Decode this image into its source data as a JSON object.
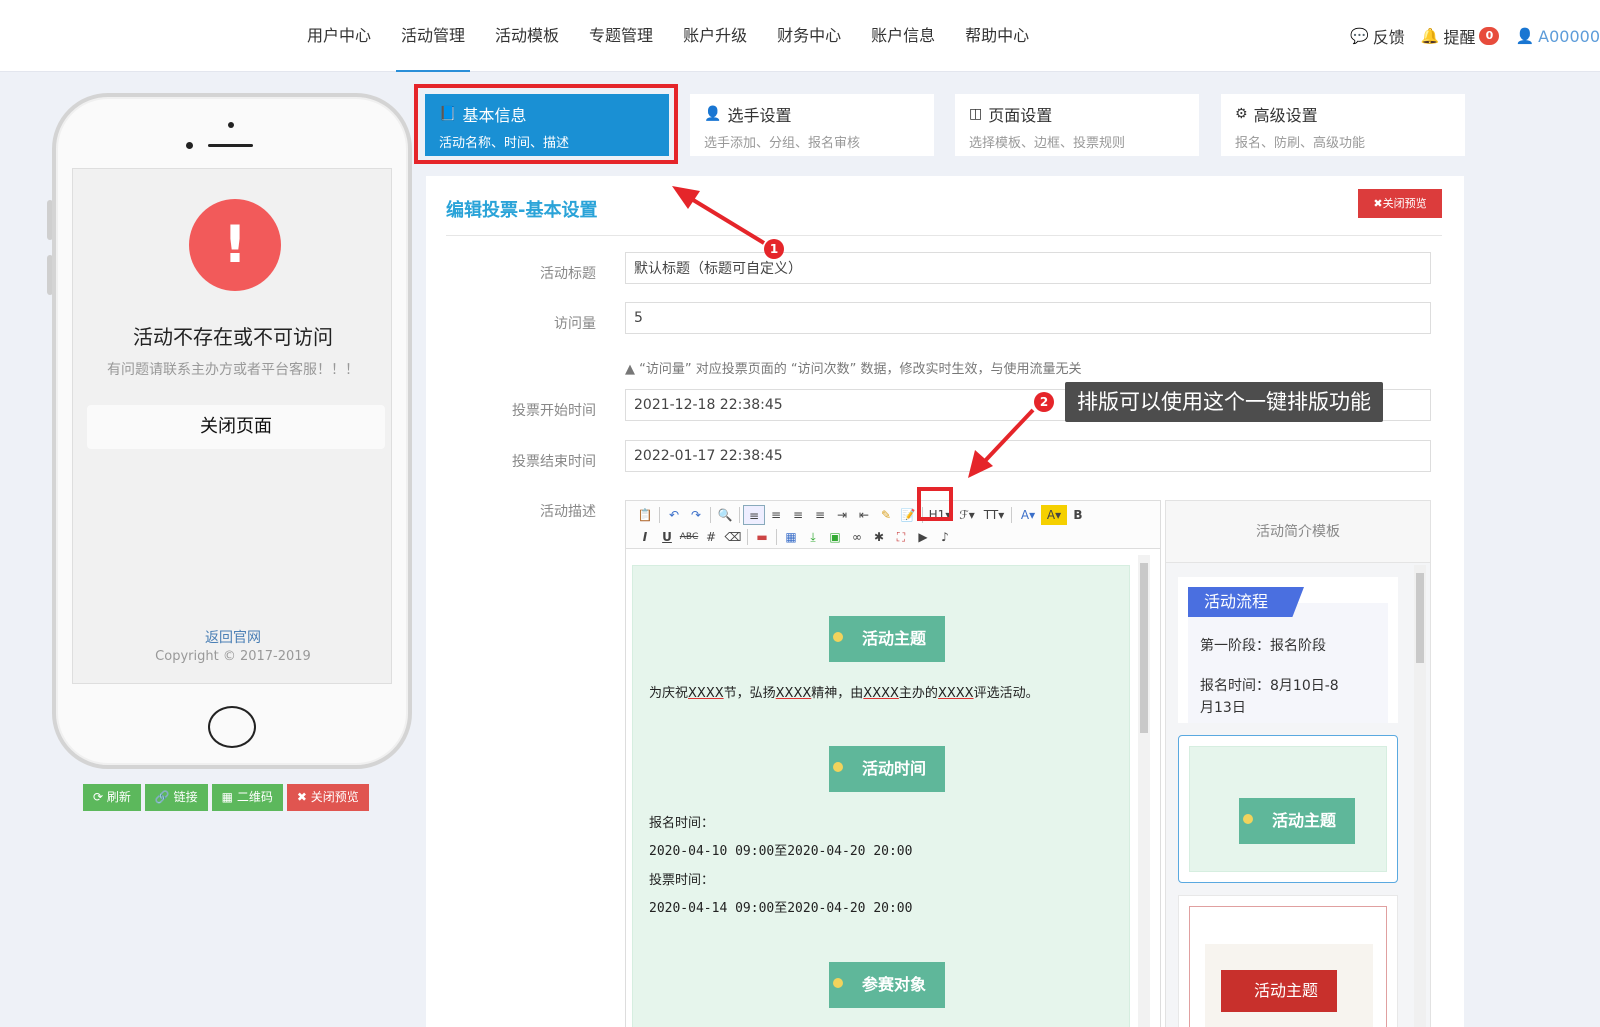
{
  "nav": {
    "items": [
      "用户中心",
      "活动管理",
      "活动模板",
      "专题管理",
      "账户升级",
      "财务中心",
      "账户信息",
      "帮助中心"
    ],
    "active_index": 1,
    "feedback": "反馈",
    "notify": "提醒",
    "notify_count": "0",
    "user": "A00000"
  },
  "phone": {
    "error_icon": "!",
    "error_title": "活动不存在或不可访问",
    "error_sub": "有问题请联系主办方或者平台客服！！！",
    "close_page": "关闭页面",
    "back_link": "返回官网",
    "copyright": "Copyright © 2017-2019",
    "buttons": {
      "refresh": "刷新",
      "link": "链接",
      "qrcode": "二维码",
      "close_preview": "关闭预览"
    }
  },
  "steps": [
    {
      "icon": "book-icon",
      "title": "基本信息",
      "sub": "活动名称、时间、描述"
    },
    {
      "icon": "user-icon",
      "title": "选手设置",
      "sub": "选手添加、分组、报名审核"
    },
    {
      "icon": "layout-icon",
      "title": "页面设置",
      "sub": "选择模板、边框、投票规则"
    },
    {
      "icon": "gear-icon",
      "title": "高级设置",
      "sub": "报名、防刷、高级功能"
    }
  ],
  "panel": {
    "title": "编辑投票-基本设置",
    "close_preview": "关闭预览",
    "fields": {
      "title_label": "活动标题",
      "title_value": "默认标题（标题可自定义）",
      "views_label": "访问量",
      "views_value": "5",
      "views_hint": "▲ “访问量” 对应投票页面的 “访问次数” 数据，修改实时生效，与使用流量无关",
      "start_label": "投票开始时间",
      "start_value": "2021-12-18 22:38:45",
      "end_label": "投票结束时间",
      "end_value": "2022-01-17 22:38:45",
      "desc_label": "活动描述"
    }
  },
  "editor": {
    "toolbar_row1": [
      "📋",
      "↶",
      "↷",
      "🔍",
      "≡",
      "≡",
      "≡",
      "≡",
      "⇥",
      "⇤",
      "✎",
      "📝",
      "H1▾",
      "ℱ▾",
      "TT▾",
      "A▾",
      "A▾",
      "B"
    ],
    "toolbar_row2": [
      "I",
      "U",
      "ABC",
      "#",
      "⌫",
      "▬",
      "▦",
      "⤓",
      "▣",
      "∞",
      "✱",
      "⛶",
      "▶",
      "♪"
    ],
    "sections": {
      "theme": "活动主题",
      "theme_text_parts": [
        "为庆祝",
        "XXXX",
        "节，弘扬",
        "XXXX",
        "精神，由",
        "XXXX",
        "主办的",
        "XXXX",
        "评选活动。"
      ],
      "time": "活动时间",
      "signup_label": "报名时间：",
      "signup_range": "2020-04-10 09:00至2020-04-20 20:00",
      "vote_label": "投票时间：",
      "vote_range": "2020-04-14 09:00至2020-04-20 20:00",
      "target": "参赛对象"
    }
  },
  "templates": {
    "header": "活动简介模板",
    "card1_tag": "活动流程",
    "card1_line1": "第一阶段：报名阶段",
    "card1_line2": "报名时间：8月10日-8",
    "card1_line3": "月13日",
    "card2_banner": "活动主题",
    "card3_banner": "活动主题"
  },
  "annotations": {
    "marker1": "1",
    "marker2": "2",
    "tooltip": "排版可以使用这个一键排版功能"
  },
  "colors": {
    "accent": "#1a90d4",
    "danger": "#dc3c3c",
    "success": "#5cb85c",
    "banner_green": "#5fb79a",
    "highlight_red": "#e5252a"
  }
}
